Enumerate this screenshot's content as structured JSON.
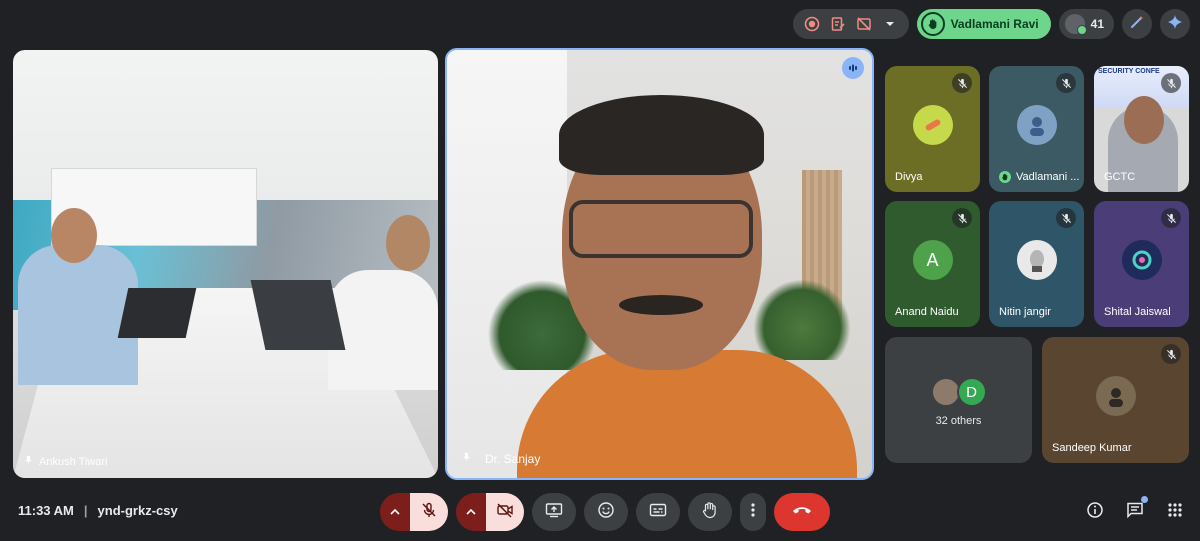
{
  "topbar": {
    "raised_hand_name": "Vadlamani Ravi",
    "participant_count": "41"
  },
  "tiles": {
    "left_main": {
      "name": "Ankush Tiwari"
    },
    "center_main": {
      "name": "Dr. Sanjay"
    },
    "grid": [
      {
        "name": "Divya"
      },
      {
        "name": "Vadlamani ..."
      },
      {
        "name": "GCTC",
        "banner_text": "SECURITY CONFE"
      },
      {
        "name": "Anand Naidu",
        "avatar_letter": "A"
      },
      {
        "name": "Nitin jangir"
      },
      {
        "name": "Shital Jaiswal"
      },
      {
        "name": "32 others",
        "avatar_letter": "D"
      },
      {
        "name": "Sandeep Kumar"
      }
    ]
  },
  "bottombar": {
    "time": "11:33 AM",
    "separator": "|",
    "meeting_code": "ynd-grkz-csy"
  },
  "colors": {
    "background": "#202124",
    "accent_blue": "#8ab4f8",
    "raised_hand_green": "#6dd58c",
    "hangup_red": "#dc362e",
    "muted_red": "#7c1f1c"
  }
}
